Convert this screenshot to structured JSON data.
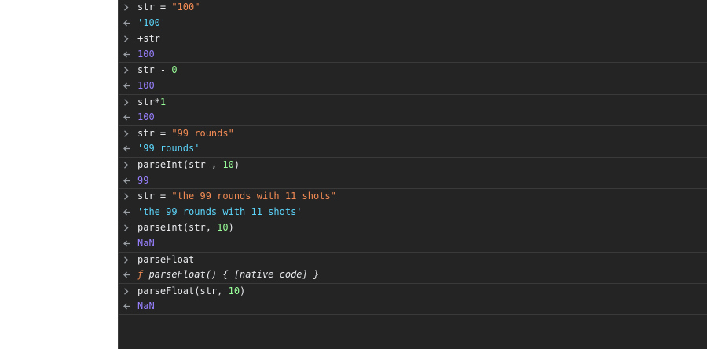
{
  "colors": {
    "background": "#242424",
    "divider": "#3a3a3a",
    "code": "#e8eaed",
    "string_input": "#f28b54",
    "number_input": "#99ff99",
    "string_result": "#5cd5fb",
    "number_result": "#9980ff",
    "prompt": "#4d8fe6"
  },
  "icons": {
    "input": "chevron-right-icon",
    "output": "return-arrow-icon",
    "prompt": "prompt-chevron-icon"
  },
  "entries": [
    {
      "input": [
        {
          "t": "str = ",
          "k": "code"
        },
        {
          "t": "\"100\"",
          "k": "str"
        }
      ],
      "output": [
        {
          "t": "'100'",
          "k": "rstr"
        }
      ]
    },
    {
      "input": [
        {
          "t": "+str",
          "k": "code"
        }
      ],
      "output": [
        {
          "t": "100",
          "k": "rnum"
        }
      ]
    },
    {
      "input": [
        {
          "t": "str - ",
          "k": "code"
        },
        {
          "t": "0",
          "k": "num"
        }
      ],
      "output": [
        {
          "t": "100",
          "k": "rnum"
        }
      ]
    },
    {
      "input": [
        {
          "t": "str*",
          "k": "code"
        },
        {
          "t": "1",
          "k": "num"
        }
      ],
      "output": [
        {
          "t": "100",
          "k": "rnum"
        }
      ]
    },
    {
      "input": [
        {
          "t": "str = ",
          "k": "code"
        },
        {
          "t": "\"99 rounds\"",
          "k": "str"
        }
      ],
      "output": [
        {
          "t": "'99 rounds'",
          "k": "rstr"
        }
      ]
    },
    {
      "input": [
        {
          "t": "parseInt(str , ",
          "k": "code"
        },
        {
          "t": "10",
          "k": "num"
        },
        {
          "t": ")",
          "k": "code"
        }
      ],
      "output": [
        {
          "t": "99",
          "k": "rnum"
        }
      ]
    },
    {
      "input": [
        {
          "t": "str = ",
          "k": "code"
        },
        {
          "t": "\"the 99 rounds with 11 shots\"",
          "k": "str"
        }
      ],
      "output": [
        {
          "t": "'the 99 rounds with 11 shots'",
          "k": "rstr"
        }
      ]
    },
    {
      "input": [
        {
          "t": "parseInt(str, ",
          "k": "code"
        },
        {
          "t": "10",
          "k": "num"
        },
        {
          "t": ")",
          "k": "code"
        }
      ],
      "output": [
        {
          "t": "NaN",
          "k": "rnum"
        }
      ]
    },
    {
      "input": [
        {
          "t": "parseFloat",
          "k": "code"
        }
      ],
      "output": [
        {
          "t": "ƒ ",
          "k": "f"
        },
        {
          "t": "parseFloat() { [native code] }",
          "k": "rfn"
        }
      ]
    },
    {
      "input": [
        {
          "t": "parseFloat(str, ",
          "k": "code"
        },
        {
          "t": "10",
          "k": "num"
        },
        {
          "t": ")",
          "k": "code"
        }
      ],
      "output": [
        {
          "t": "NaN",
          "k": "rnum"
        }
      ]
    }
  ],
  "prompt": {
    "value": ""
  }
}
